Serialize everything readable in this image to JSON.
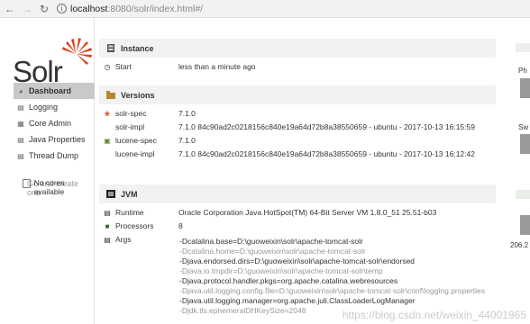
{
  "browser": {
    "back_icon": "arrow-left",
    "forward_icon": "arrow-right",
    "reload_icon": "reload",
    "url_host": "localhost",
    "url_rest": ":8080/solr/index.html#/"
  },
  "logo": {
    "text": "Solr",
    "brand_color": "#d9411e"
  },
  "sidebar": {
    "items": [
      {
        "label": "Dashboard",
        "icon": "dashboard-icon",
        "active": true
      },
      {
        "label": "Logging",
        "icon": "logging-icon",
        "active": false
      },
      {
        "label": "Core Admin",
        "icon": "core-admin-icon",
        "active": false
      },
      {
        "label": "Java Properties",
        "icon": "java-properties-icon",
        "active": false
      },
      {
        "label": "Thread Dump",
        "icon": "thread-dump-icon",
        "active": false
      }
    ],
    "cores": {
      "title": "No cores available",
      "subtitle": "Go and create one"
    }
  },
  "instance": {
    "title": "Instance",
    "start_label": "Start",
    "start_value": "less than a minute ago"
  },
  "versions": {
    "title": "Versions",
    "rows": [
      {
        "label": "solr-spec",
        "value": "7.1.0"
      },
      {
        "label": "solr-impl",
        "value": "7.1.0 84c90ad2c0218156c840e19a64d72b8a38550659 - ubuntu - 2017-10-13 16:15:59"
      },
      {
        "label": "lucene-spec",
        "value": "7.1.0"
      },
      {
        "label": "lucene-impl",
        "value": "7.1.0 84c90ad2c0218156c840e19a64d72b8a38550659 - ubuntu - 2017-10-13 16:12:42"
      }
    ]
  },
  "jvm": {
    "title": "JVM",
    "runtime_label": "Runtime",
    "runtime_value": "Oracle Corporation Java HotSpot(TM) 64-Bit Server VM 1.8.0_51 25.51-b03",
    "processors_label": "Processors",
    "processors_value": "8",
    "args_label": "Args",
    "args": [
      "-Dcatalina.base=D:\\guoweixin\\solr\\apache-tomcat-solr",
      "-Dcatalina.home=D:\\guoweixin\\solr\\apache-tomcat-solr",
      "-Djava.endorsed.dirs=D:\\guoweixin\\solr\\apache-tomcat-solr\\endorsed",
      "-Djava.io.tmpdir=D:\\guoweixin\\solr\\apache-tomcat-solr\\temp",
      "-Djava.protocol.handler.pkgs=org.apache.catalina.webresources",
      "-Djava.util.logging.config.file=D:\\guoweixin\\solr\\apache-tomcat-solr\\conf\\logging.properties",
      "-Djava.util.logging.manager=org.apache.juli.ClassLoaderLogManager",
      "-Djdk.tls.ephemeralDHKeySize=2048"
    ]
  },
  "right_panel": {
    "label_1": "Ph",
    "label_2": "Sw",
    "label_3": "206.2"
  },
  "watermark": "https://blog.csdn.net/weixin_44001965"
}
